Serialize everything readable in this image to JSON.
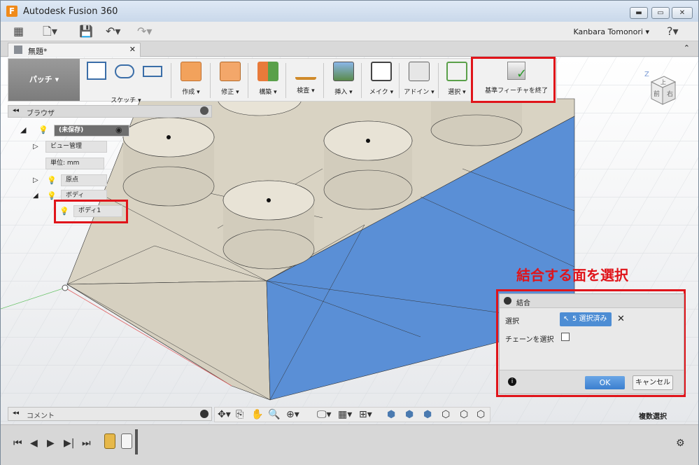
{
  "window": {
    "title": "Autodesk Fusion 360",
    "app_letter": "F"
  },
  "appbar": {
    "user": "Kanbara Tomonori"
  },
  "document_tab": {
    "label": "無題*"
  },
  "toolbar": {
    "workspace": "パッチ",
    "items": [
      "スケッチ",
      "作成",
      "修正",
      "構築",
      "検査",
      "挿入",
      "メイク",
      "アドイン",
      "選択"
    ],
    "finish_label": "基準フィーチャを終了"
  },
  "browser": {
    "title": "ブラウザ",
    "root": "(未保存)",
    "nodes": [
      "ビュー管理",
      "単位: mm",
      "原点",
      "ボディ",
      "ボディ1"
    ]
  },
  "viewcube": {
    "top": "上",
    "front": "前",
    "right": "右",
    "z": "Z"
  },
  "annotation": "結合する面を選択",
  "dialog": {
    "title": "結合",
    "select_label": "選択",
    "select_value": "5 選択済み",
    "chain_label": "チェーンを選択",
    "ok": "OK",
    "cancel": "キャンセル"
  },
  "comment": {
    "label": "コメント"
  },
  "status": {
    "multi_select": "複数選択"
  },
  "colors": {
    "accent": "#e0141a",
    "body_face": "#5a8fd6",
    "body_top": "#d7d2c2"
  }
}
